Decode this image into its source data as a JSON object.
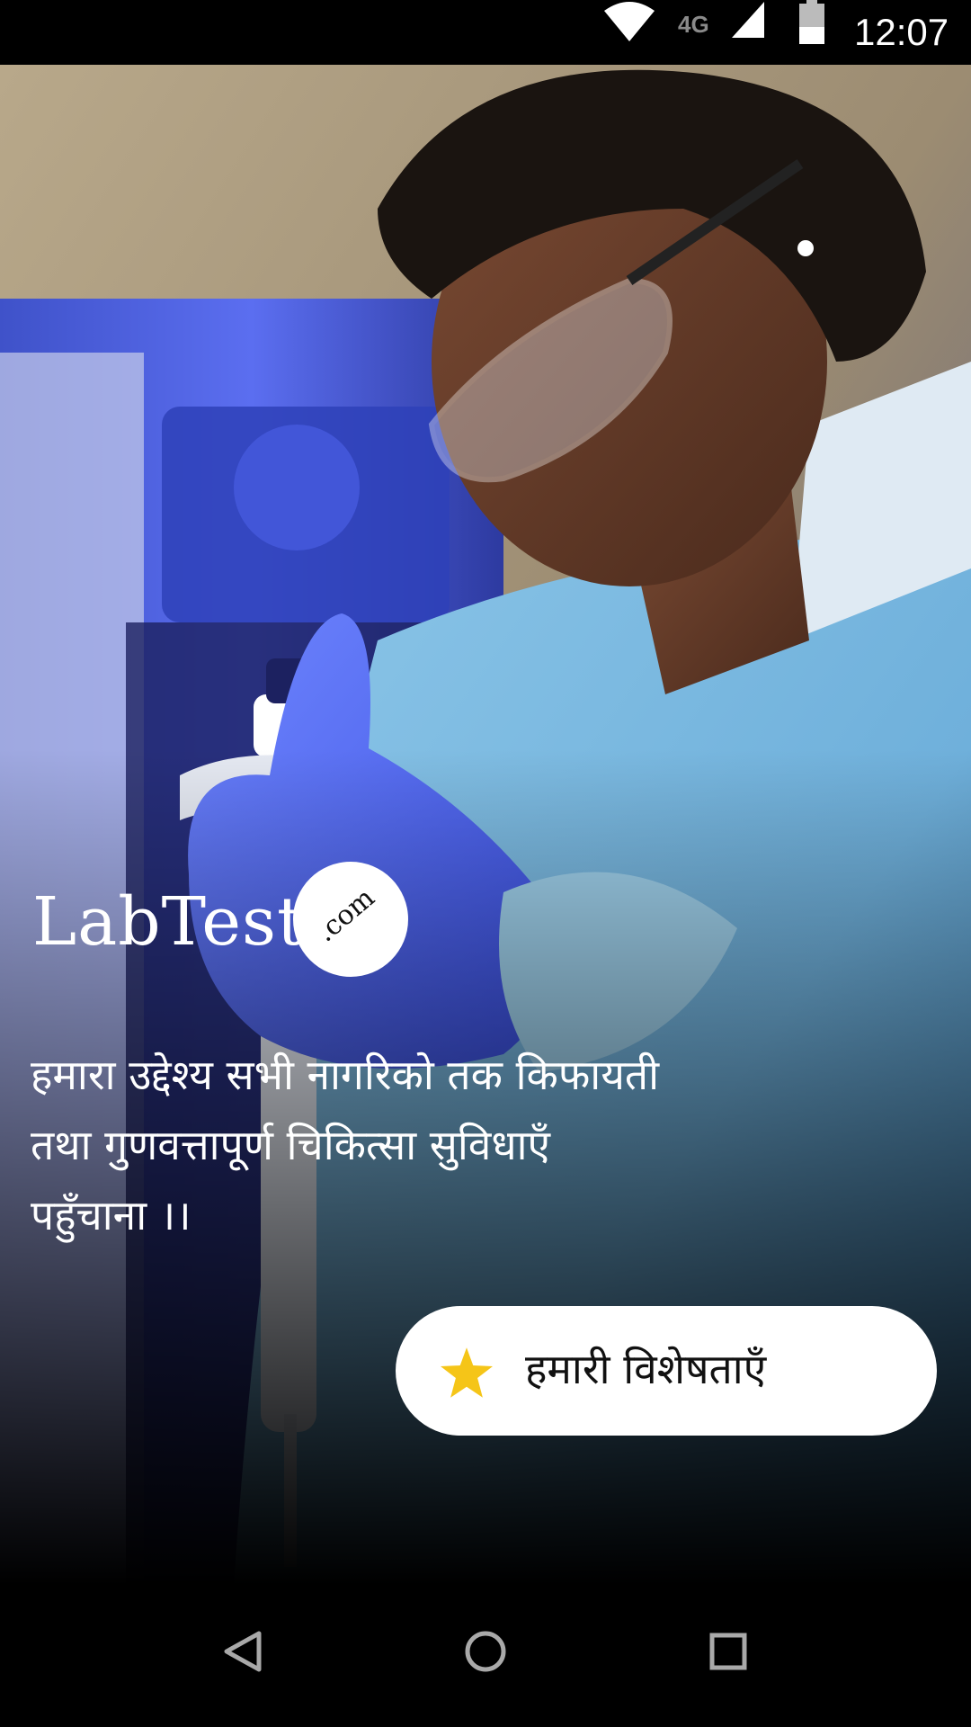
{
  "status_bar": {
    "network_type": "4G",
    "time": "12:07",
    "icons": [
      "wifi-icon",
      "signal-icon",
      "battery-icon"
    ]
  },
  "logo": {
    "name": "LabTest",
    "badge": ".com"
  },
  "mission": {
    "lines": [
      "हमारा उद्देश्य सभी नागरिको तक किफायती",
      "तथा गुणवत्तापूर्ण चिकित्सा सुविधाएँ",
      "पहुँचाना ।।"
    ]
  },
  "features_button": {
    "label": "हमारी  विशेषताएँ",
    "icon": "star-icon",
    "icon_color": "#F5C518"
  },
  "nav_bar": {
    "icons": [
      "back-icon",
      "home-icon",
      "recents-icon"
    ]
  },
  "colors": {
    "background": "#000000",
    "button_bg": "#FFFFFF",
    "accent_star": "#F5C518",
    "photo_tint": "#3D55D6"
  }
}
